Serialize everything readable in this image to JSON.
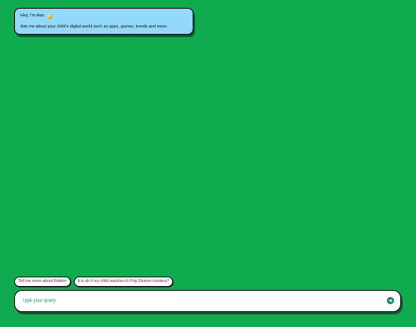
{
  "bot_message": {
    "greeting": "Hey, I'm Aan.",
    "greeting_icon": "waving-hand-icon",
    "intro": "Ask me about your child's digital world such as apps, games, trends and more."
  },
  "suggestions": [
    {
      "label": "Tell me more about Roblox"
    },
    {
      "label": "It is ok if my child watches K-Pop Demon Hunters?"
    }
  ],
  "query": {
    "placeholder": "Type your query",
    "value": ""
  },
  "send_icon": "arrow-right-circle-icon",
  "colors": {
    "background": "#10ab4f",
    "bot_bubble": "#92d9fb",
    "chip_text": "#a00a6a",
    "accent": "#0f8f5c"
  }
}
